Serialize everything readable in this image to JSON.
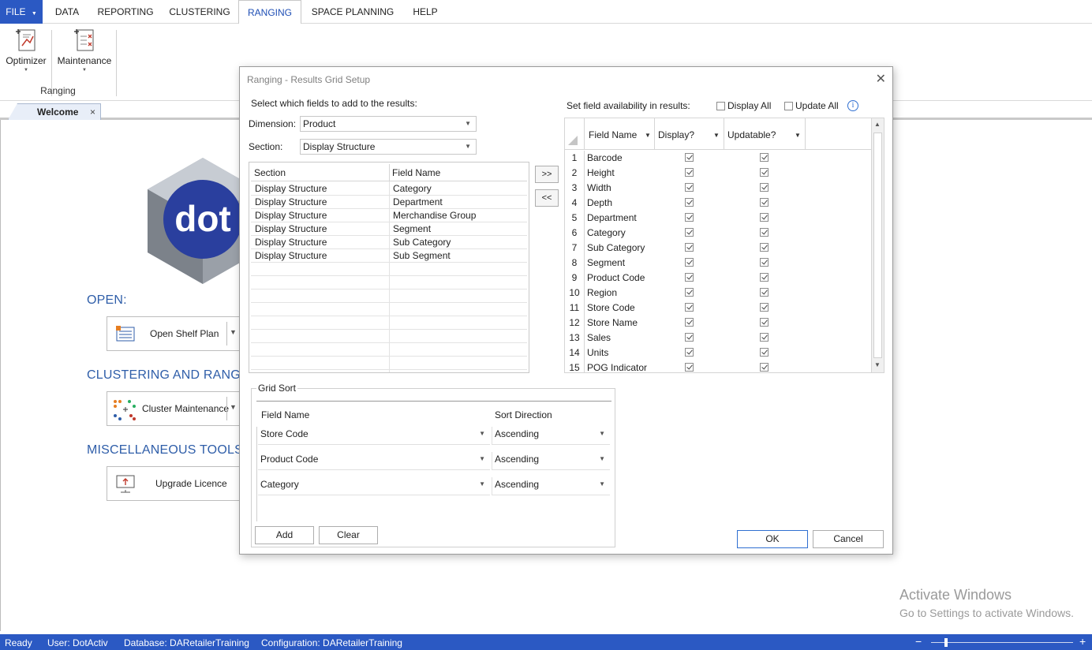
{
  "menu": {
    "file": "FILE",
    "items": [
      "DATA",
      "REPORTING",
      "CLUSTERING",
      "RANGING",
      "SPACE PLANNING",
      "HELP"
    ]
  },
  "ribbon": {
    "optimizer": "Optimizer",
    "maintenance": "Maintenance",
    "group_label": "Ranging"
  },
  "tab": {
    "label": "Welcome",
    "close": "×"
  },
  "welcome": {
    "logo_text": "dot",
    "open_heading": "OPEN:",
    "open_shelf_plan": "Open Shelf Plan",
    "clustering_heading": "CLUSTERING AND RANGING:",
    "cluster_maintenance": "Cluster Maintenance",
    "misc_heading": "MISCELLANEOUS TOOLS:",
    "upgrade_licence": "Upgrade Licence"
  },
  "watermark": {
    "line1": "Activate Windows",
    "line2": "Go to Settings to activate Windows."
  },
  "status": {
    "ready": "Ready",
    "user": "User: DotActiv",
    "database": "Database: DARetailerTraining",
    "configuration": "Configuration: DARetailerTraining"
  },
  "dialog": {
    "title": "Ranging - Results Grid Setup",
    "select_prompt": "Select which fields to add to the results:",
    "dimension_label": "Dimension:",
    "dimension_value": "Product",
    "section_label": "Section:",
    "section_value": "Display Structure",
    "left_grid": {
      "headers": [
        "Section",
        "Field Name"
      ],
      "rows": [
        [
          "Display Structure",
          "Category"
        ],
        [
          "Display Structure",
          "Department"
        ],
        [
          "Display Structure",
          "Merchandise Group"
        ],
        [
          "Display Structure",
          "Segment"
        ],
        [
          "Display Structure",
          "Sub Category"
        ],
        [
          "Display Structure",
          "Sub Segment"
        ]
      ]
    },
    "add_arrow": ">>",
    "remove_arrow": "<<",
    "availability_prompt": "Set field availability in results:",
    "display_all": "Display All",
    "update_all": "Update All",
    "right_grid": {
      "headers": [
        "Field Name",
        "Display?",
        "Updatable?"
      ],
      "rows": [
        {
          "num": "1",
          "name": "Barcode",
          "display": true,
          "updatable": true
        },
        {
          "num": "2",
          "name": "Height",
          "display": true,
          "updatable": true
        },
        {
          "num": "3",
          "name": "Width",
          "display": true,
          "updatable": true
        },
        {
          "num": "4",
          "name": "Depth",
          "display": true,
          "updatable": true
        },
        {
          "num": "5",
          "name": "Department",
          "display": true,
          "updatable": true
        },
        {
          "num": "6",
          "name": "Category",
          "display": true,
          "updatable": true
        },
        {
          "num": "7",
          "name": "Sub Category",
          "display": true,
          "updatable": true
        },
        {
          "num": "8",
          "name": "Segment",
          "display": true,
          "updatable": true
        },
        {
          "num": "9",
          "name": "Product Code",
          "display": true,
          "updatable": true
        },
        {
          "num": "10",
          "name": "Region",
          "display": true,
          "updatable": true
        },
        {
          "num": "11",
          "name": "Store Code",
          "display": true,
          "updatable": true
        },
        {
          "num": "12",
          "name": "Store Name",
          "display": true,
          "updatable": true
        },
        {
          "num": "13",
          "name": "Sales",
          "display": true,
          "updatable": true
        },
        {
          "num": "14",
          "name": "Units",
          "display": true,
          "updatable": true
        },
        {
          "num": "15",
          "name": "POG Indicator",
          "display": true,
          "updatable": true
        }
      ]
    },
    "grid_sort": {
      "title": "Grid Sort",
      "headers": [
        "Field Name",
        "Sort Direction"
      ],
      "rows": [
        {
          "field": "Store Code",
          "direction": "Ascending"
        },
        {
          "field": "Product Code",
          "direction": "Ascending"
        },
        {
          "field": "Category",
          "direction": "Ascending"
        }
      ],
      "add": "Add",
      "clear": "Clear"
    },
    "ok": "OK",
    "cancel": "Cancel"
  },
  "colors": {
    "accent": "#2b59c3",
    "heading_blue": "#2f5ea9",
    "logo_blue": "#2a3f9e"
  }
}
